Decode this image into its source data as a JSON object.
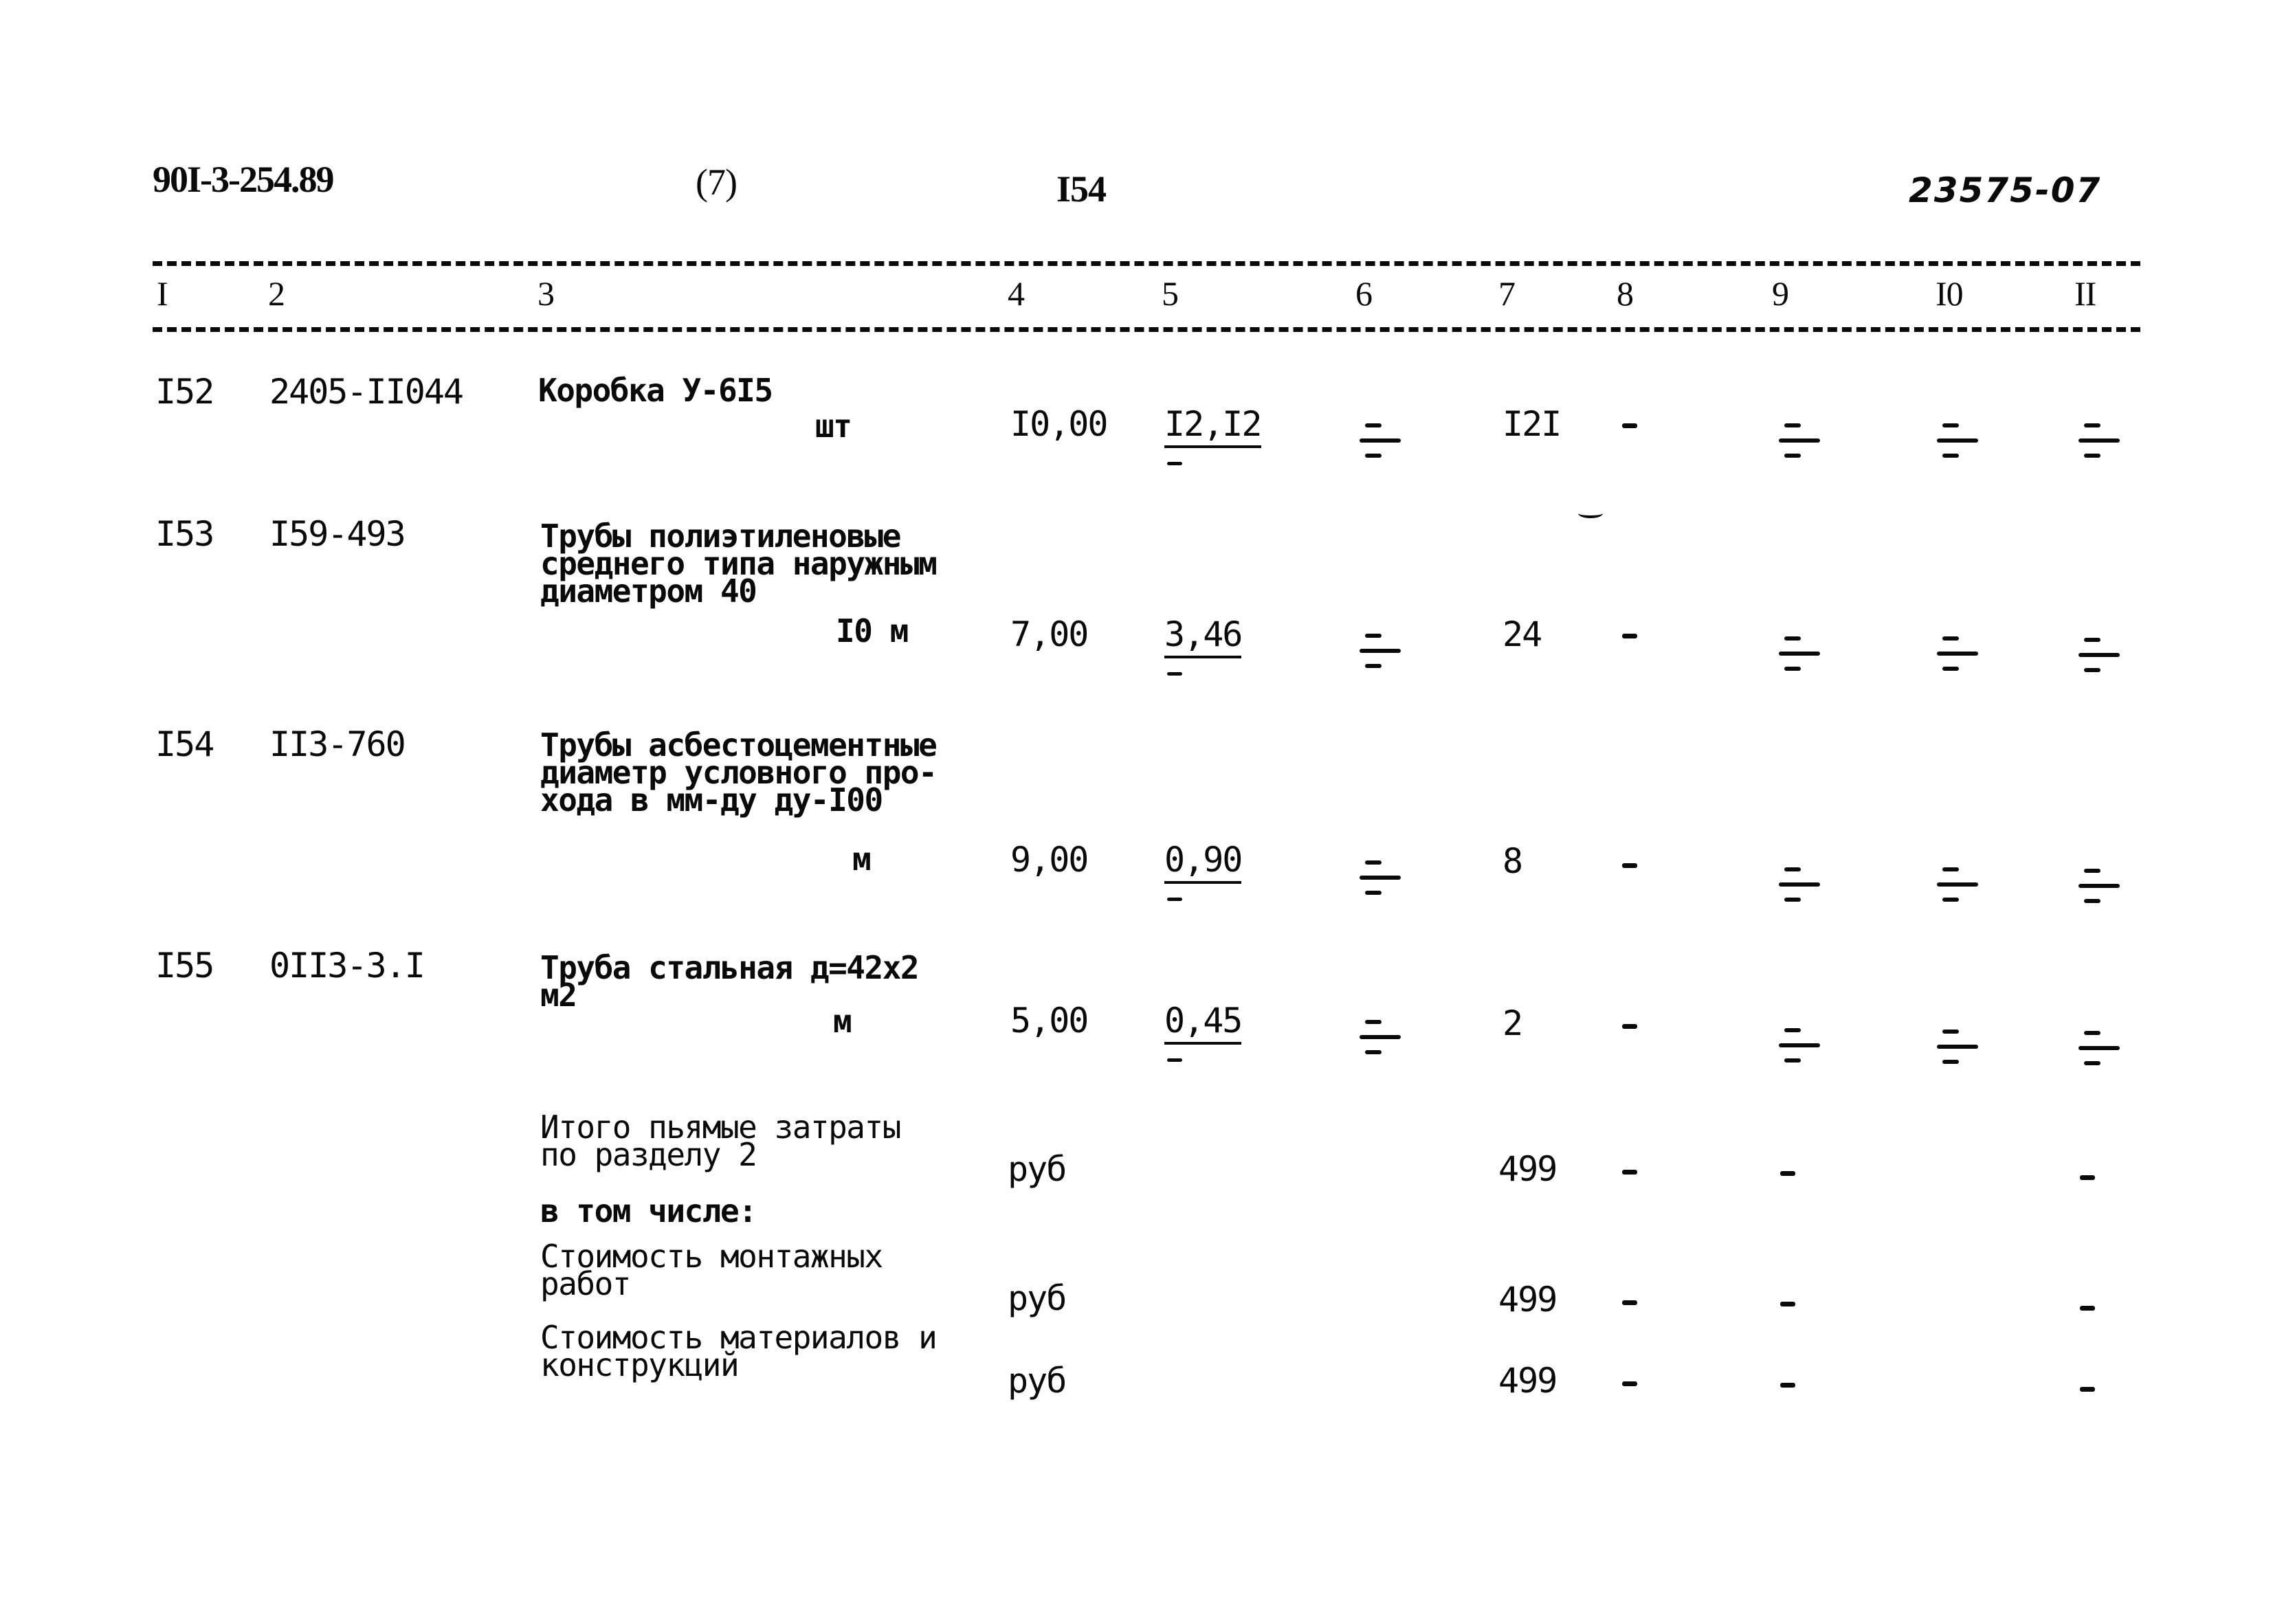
{
  "header": {
    "doc_code": "90I-3-254.89",
    "sheet": "(7)",
    "page": "I54",
    "inventory_number": "23575-07"
  },
  "columns": [
    "I",
    "2",
    "3",
    "4",
    "5",
    "6",
    "7",
    "8",
    "9",
    "I0",
    "II"
  ],
  "rows": [
    {
      "num": "I52",
      "code": "2405-II044",
      "description": "Коробка У-6I5",
      "unit": "шт",
      "quantity": "I0,00",
      "unit_price": "I2,I2",
      "col6": "–/–",
      "total": "I2I",
      "col8": "-",
      "col9": "–/–",
      "col10": "–/–",
      "col11": "–/–"
    },
    {
      "num": "I53",
      "code": "I59-493",
      "description": "Трубы полиэтиленовые\nсреднего типа наружным\nдиаметром 40",
      "unit": "I0 м",
      "quantity": "7,00",
      "unit_price": "3,46",
      "col6": "–/–",
      "total": "24",
      "col8": "-",
      "col9": "–/–",
      "col10": "–/–",
      "col11": "–/–"
    },
    {
      "num": "I54",
      "code": "II3-760",
      "description": "Трубы асбестоцементные\nдиаметр условного про-\nхода в мм-ду ду-I00",
      "unit": "м",
      "quantity": "9,00",
      "unit_price": "0,90",
      "col6": "–/–",
      "total": "8",
      "col8": "-",
      "col9": "–/–",
      "col10": "–/–",
      "col11": "–/–"
    },
    {
      "num": "I55",
      "code": "0II3-3.I",
      "description": "Труба стальная д=42х2\nм2",
      "unit": "м",
      "quantity": "5,00",
      "unit_price": "0,45",
      "col6": "–/–",
      "total": "2",
      "col8": "-",
      "col9": "–/–",
      "col10": "–/–",
      "col11": "–/–"
    }
  ],
  "totals": [
    {
      "label": "Итого пьямые затраты\nпо разделу 2",
      "unit": "руб",
      "total": "499",
      "col8": "-",
      "col9": "-",
      "col11": "-"
    },
    {
      "label": "в том числе:"
    },
    {
      "label": "Стоимость монтажных\nработ",
      "unit": "руб",
      "total": "499",
      "col8": "-",
      "col9": "-",
      "col11": "-"
    },
    {
      "label": "Стоимость материалов и\nконструкций",
      "unit": "руб",
      "total": "499",
      "col8": "-",
      "col9": "-",
      "col11": "-"
    }
  ]
}
